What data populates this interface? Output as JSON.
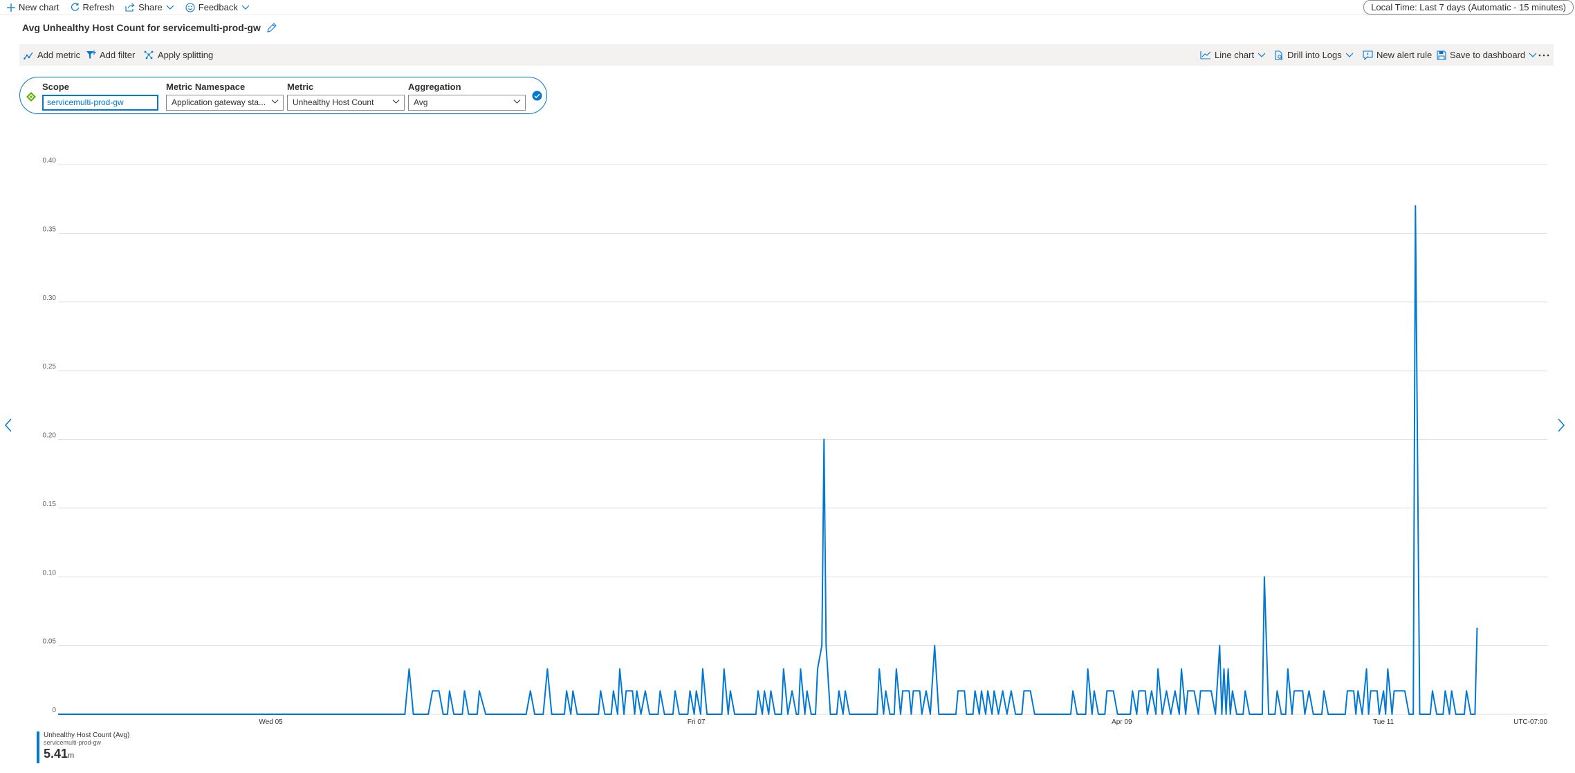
{
  "toolbar": {
    "new_chart": "New chart",
    "refresh": "Refresh",
    "share": "Share",
    "feedback": "Feedback",
    "time_range": "Local Time: Last 7 days (Automatic - 15 minutes)"
  },
  "chart_title": "Avg Unhealthy Host Count for servicemulti-prod-gw",
  "commands": {
    "add_metric": "Add metric",
    "add_filter": "Add filter",
    "apply_splitting": "Apply splitting",
    "line_chart": "Line chart",
    "drill_into_logs": "Drill into Logs",
    "new_alert_rule": "New alert rule",
    "save_to_dashboard": "Save to dashboard"
  },
  "metric_row": {
    "scope_label": "Scope",
    "scope_value": "servicemulti-prod-gw",
    "namespace_label": "Metric Namespace",
    "namespace_value": "Application gateway sta...",
    "metric_label": "Metric",
    "metric_value": "Unhealthy Host Count",
    "aggregation_label": "Aggregation",
    "aggregation_value": "Avg"
  },
  "legend": {
    "series_name": "Unhealthy Host Count (Avg)",
    "resource": "servicemulti-prod-gw",
    "value": "5.41",
    "unit": "m"
  },
  "colors": {
    "accent": "#0078d4",
    "grid": "#e1dfdd"
  },
  "chart_data": {
    "type": "line",
    "ylim": [
      0,
      0.4
    ],
    "yticks": [
      "0",
      "0.05",
      "0.10",
      "0.15",
      "0.20",
      "0.25",
      "0.30",
      "0.35",
      "0.40"
    ],
    "xticks": [
      "Wed 05",
      "Fri 07",
      "Apr 09",
      "Tue 11"
    ],
    "timezone_label": "UTC-07:00",
    "x_domain_days": [
      0,
      7
    ],
    "series": [
      {
        "name": "Unhealthy Host Count (Avg)",
        "color": "#0078d4",
        "points": [
          [
            0.0,
            0
          ],
          [
            1.63,
            0
          ],
          [
            1.65,
            0.033
          ],
          [
            1.67,
            0
          ],
          [
            1.74,
            0
          ],
          [
            1.76,
            0.017
          ],
          [
            1.79,
            0.017
          ],
          [
            1.81,
            0
          ],
          [
            1.83,
            0
          ],
          [
            1.84,
            0.017
          ],
          [
            1.86,
            0
          ],
          [
            1.9,
            0
          ],
          [
            1.91,
            0.017
          ],
          [
            1.93,
            0
          ],
          [
            1.97,
            0
          ],
          [
            1.98,
            0.017
          ],
          [
            2.01,
            0
          ],
          [
            2.2,
            0
          ],
          [
            2.22,
            0.017
          ],
          [
            2.24,
            0
          ],
          [
            2.28,
            0
          ],
          [
            2.3,
            0.033
          ],
          [
            2.32,
            0
          ],
          [
            2.38,
            0
          ],
          [
            2.39,
            0.017
          ],
          [
            2.41,
            0
          ],
          [
            2.42,
            0.017
          ],
          [
            2.44,
            0
          ],
          [
            2.54,
            0
          ],
          [
            2.55,
            0.017
          ],
          [
            2.57,
            0
          ],
          [
            2.6,
            0
          ],
          [
            2.61,
            0.017
          ],
          [
            2.63,
            0
          ],
          [
            2.64,
            0.033
          ],
          [
            2.66,
            0
          ],
          [
            2.67,
            0.017
          ],
          [
            2.7,
            0.017
          ],
          [
            2.71,
            0
          ],
          [
            2.72,
            0.017
          ],
          [
            2.74,
            0
          ],
          [
            2.76,
            0.017
          ],
          [
            2.78,
            0
          ],
          [
            2.82,
            0
          ],
          [
            2.83,
            0.017
          ],
          [
            2.85,
            0
          ],
          [
            2.89,
            0
          ],
          [
            2.9,
            0.017
          ],
          [
            2.92,
            0
          ],
          [
            2.96,
            0
          ],
          [
            2.97,
            0.017
          ],
          [
            2.99,
            0
          ],
          [
            3.0,
            0.017
          ],
          [
            3.02,
            0
          ],
          [
            3.03,
            0.033
          ],
          [
            3.05,
            0
          ],
          [
            3.12,
            0
          ],
          [
            3.13,
            0.033
          ],
          [
            3.15,
            0
          ],
          [
            3.16,
            0.017
          ],
          [
            3.18,
            0
          ],
          [
            3.28,
            0
          ],
          [
            3.29,
            0.017
          ],
          [
            3.31,
            0
          ],
          [
            3.32,
            0.017
          ],
          [
            3.34,
            0
          ],
          [
            3.35,
            0.017
          ],
          [
            3.37,
            0
          ],
          [
            3.4,
            0
          ],
          [
            3.41,
            0.033
          ],
          [
            3.43,
            0
          ],
          [
            3.45,
            0.017
          ],
          [
            3.47,
            0
          ],
          [
            3.48,
            0
          ],
          [
            3.49,
            0.033
          ],
          [
            3.51,
            0
          ],
          [
            3.52,
            0.017
          ],
          [
            3.54,
            0
          ],
          [
            3.56,
            0
          ],
          [
            3.57,
            0.033
          ],
          [
            3.59,
            0.05
          ],
          [
            3.6,
            0.2
          ],
          [
            3.61,
            0.05
          ],
          [
            3.63,
            0
          ],
          [
            3.66,
            0
          ],
          [
            3.67,
            0.017
          ],
          [
            3.69,
            0
          ],
          [
            3.7,
            0.017
          ],
          [
            3.72,
            0
          ],
          [
            3.85,
            0
          ],
          [
            3.86,
            0.033
          ],
          [
            3.88,
            0
          ],
          [
            3.89,
            0.017
          ],
          [
            3.91,
            0
          ],
          [
            3.93,
            0
          ],
          [
            3.94,
            0.033
          ],
          [
            3.96,
            0
          ],
          [
            3.97,
            0.017
          ],
          [
            4.0,
            0.017
          ],
          [
            4.01,
            0
          ],
          [
            4.02,
            0.017
          ],
          [
            4.05,
            0.017
          ],
          [
            4.06,
            0
          ],
          [
            4.08,
            0.017
          ],
          [
            4.1,
            0
          ],
          [
            4.12,
            0.05
          ],
          [
            4.14,
            0
          ],
          [
            4.22,
            0
          ],
          [
            4.23,
            0.017
          ],
          [
            4.26,
            0.017
          ],
          [
            4.27,
            0
          ],
          [
            4.3,
            0
          ],
          [
            4.31,
            0.017
          ],
          [
            4.33,
            0
          ],
          [
            4.34,
            0.017
          ],
          [
            4.36,
            0
          ],
          [
            4.37,
            0.017
          ],
          [
            4.39,
            0
          ],
          [
            4.4,
            0.017
          ],
          [
            4.42,
            0
          ],
          [
            4.44,
            0.017
          ],
          [
            4.46,
            0
          ],
          [
            4.48,
            0.017
          ],
          [
            4.5,
            0
          ],
          [
            4.53,
            0
          ],
          [
            4.54,
            0.017
          ],
          [
            4.57,
            0.017
          ],
          [
            4.59,
            0
          ],
          [
            4.76,
            0
          ],
          [
            4.77,
            0.017
          ],
          [
            4.79,
            0
          ],
          [
            4.83,
            0
          ],
          [
            4.84,
            0.033
          ],
          [
            4.86,
            0
          ],
          [
            4.87,
            0.017
          ],
          [
            4.89,
            0
          ],
          [
            4.92,
            0
          ],
          [
            4.93,
            0.017
          ],
          [
            4.96,
            0.017
          ],
          [
            4.98,
            0
          ],
          [
            5.04,
            0
          ],
          [
            5.05,
            0.017
          ],
          [
            5.07,
            0
          ],
          [
            5.08,
            0.017
          ],
          [
            5.11,
            0.017
          ],
          [
            5.12,
            0
          ],
          [
            5.14,
            0.017
          ],
          [
            5.16,
            0
          ],
          [
            5.17,
            0.033
          ],
          [
            5.19,
            0
          ],
          [
            5.21,
            0.017
          ],
          [
            5.23,
            0
          ],
          [
            5.25,
            0.017
          ],
          [
            5.27,
            0
          ],
          [
            5.28,
            0.033
          ],
          [
            5.3,
            0
          ],
          [
            5.31,
            0.017
          ],
          [
            5.34,
            0.017
          ],
          [
            5.36,
            0
          ],
          [
            5.37,
            0.017
          ],
          [
            5.42,
            0.017
          ],
          [
            5.44,
            0
          ],
          [
            5.46,
            0.05
          ],
          [
            5.47,
            0
          ],
          [
            5.48,
            0.033
          ],
          [
            5.49,
            0
          ],
          [
            5.5,
            0.033
          ],
          [
            5.51,
            0
          ],
          [
            5.52,
            0.017
          ],
          [
            5.54,
            0
          ],
          [
            5.57,
            0
          ],
          [
            5.58,
            0.017
          ],
          [
            5.6,
            0
          ],
          [
            5.66,
            0
          ],
          [
            5.67,
            0.1
          ],
          [
            5.69,
            0
          ],
          [
            5.72,
            0
          ],
          [
            5.73,
            0.017
          ],
          [
            5.75,
            0
          ],
          [
            5.77,
            0
          ],
          [
            5.78,
            0.033
          ],
          [
            5.8,
            0
          ],
          [
            5.81,
            0.017
          ],
          [
            5.85,
            0.017
          ],
          [
            5.86,
            0
          ],
          [
            5.88,
            0.017
          ],
          [
            5.9,
            0
          ],
          [
            5.94,
            0
          ],
          [
            5.95,
            0.017
          ],
          [
            5.97,
            0
          ],
          [
            6.05,
            0
          ],
          [
            6.06,
            0.017
          ],
          [
            6.09,
            0.017
          ],
          [
            6.1,
            0
          ],
          [
            6.11,
            0.017
          ],
          [
            6.13,
            0
          ],
          [
            6.15,
            0.033
          ],
          [
            6.16,
            0
          ],
          [
            6.17,
            0.017
          ],
          [
            6.2,
            0.017
          ],
          [
            6.21,
            0
          ],
          [
            6.23,
            0.017
          ],
          [
            6.24,
            0
          ],
          [
            6.25,
            0.033
          ],
          [
            6.27,
            0
          ],
          [
            6.28,
            0.017
          ],
          [
            6.33,
            0.017
          ],
          [
            6.35,
            0
          ],
          [
            6.37,
            0
          ],
          [
            6.38,
            0.37
          ],
          [
            6.4,
            0
          ],
          [
            6.45,
            0
          ],
          [
            6.46,
            0.017
          ],
          [
            6.48,
            0
          ],
          [
            6.51,
            0
          ],
          [
            6.52,
            0.017
          ],
          [
            6.54,
            0
          ],
          [
            6.55,
            0.017
          ],
          [
            6.57,
            0
          ],
          [
            6.61,
            0
          ],
          [
            6.62,
            0.017
          ],
          [
            6.64,
            0
          ],
          [
            6.66,
            0
          ],
          [
            6.67,
            0.063
          ]
        ]
      }
    ]
  }
}
